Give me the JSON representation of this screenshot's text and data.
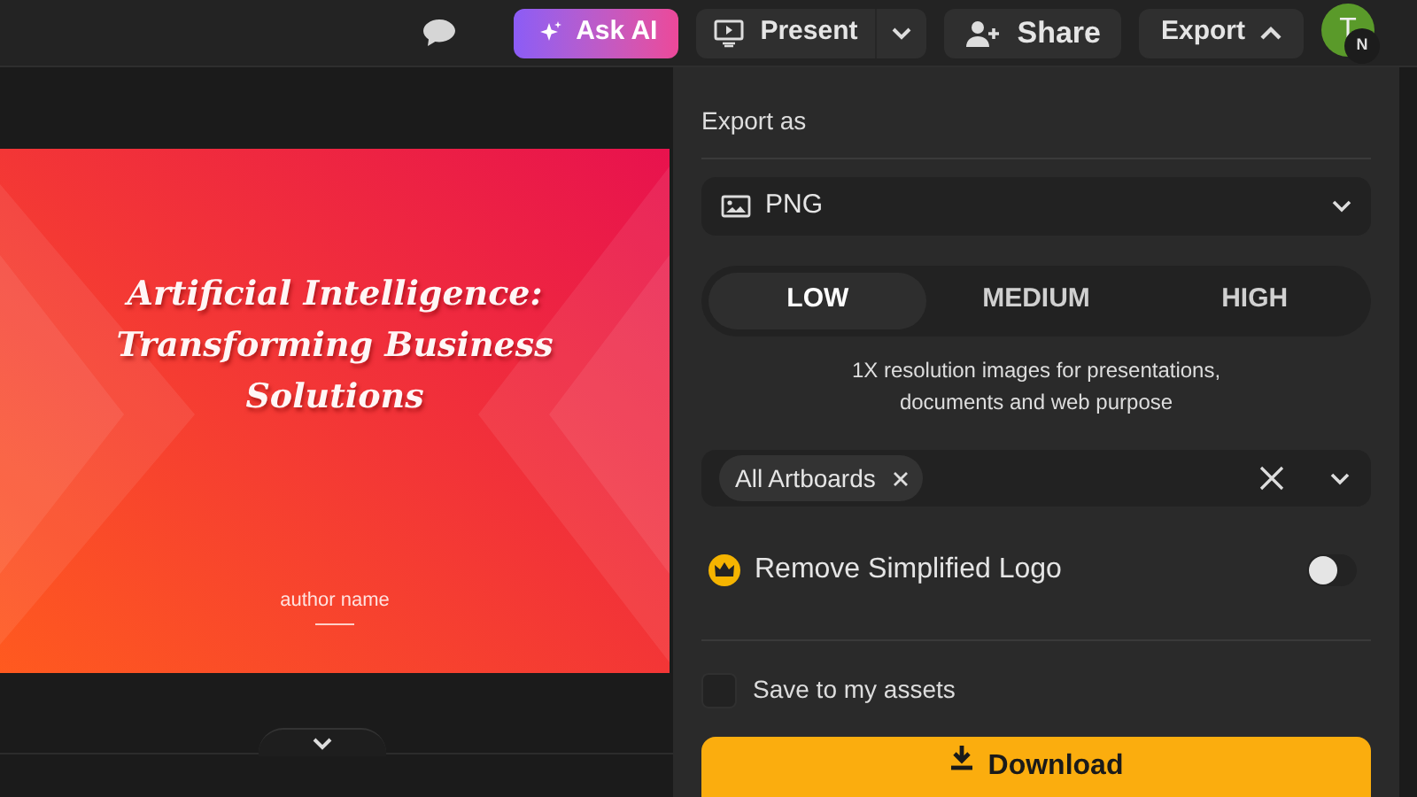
{
  "toolbar": {
    "ask_ai": "Ask AI",
    "present": "Present",
    "share": "Share",
    "export": {
      "label": "Export",
      "expanded": true
    },
    "avatar": {
      "initial": "T",
      "badge": "N"
    }
  },
  "slide": {
    "title": "Artificial Intelligence: Transforming Business Solutions",
    "author": "author name"
  },
  "export_panel": {
    "heading": "Export as",
    "format": "PNG",
    "quality": [
      {
        "label": "LOW",
        "selected": true
      },
      {
        "label": "MEDIUM",
        "selected": false
      },
      {
        "label": "HIGH",
        "selected": false
      }
    ],
    "description": "1X resolution images for presentations, documents and web purpose",
    "artboards": [
      "All Artboards"
    ],
    "remove_logo": {
      "label": "Remove Simplified Logo",
      "on": false
    },
    "save_assets": {
      "label": "Save to my assets",
      "checked": false
    },
    "download": "Download"
  }
}
